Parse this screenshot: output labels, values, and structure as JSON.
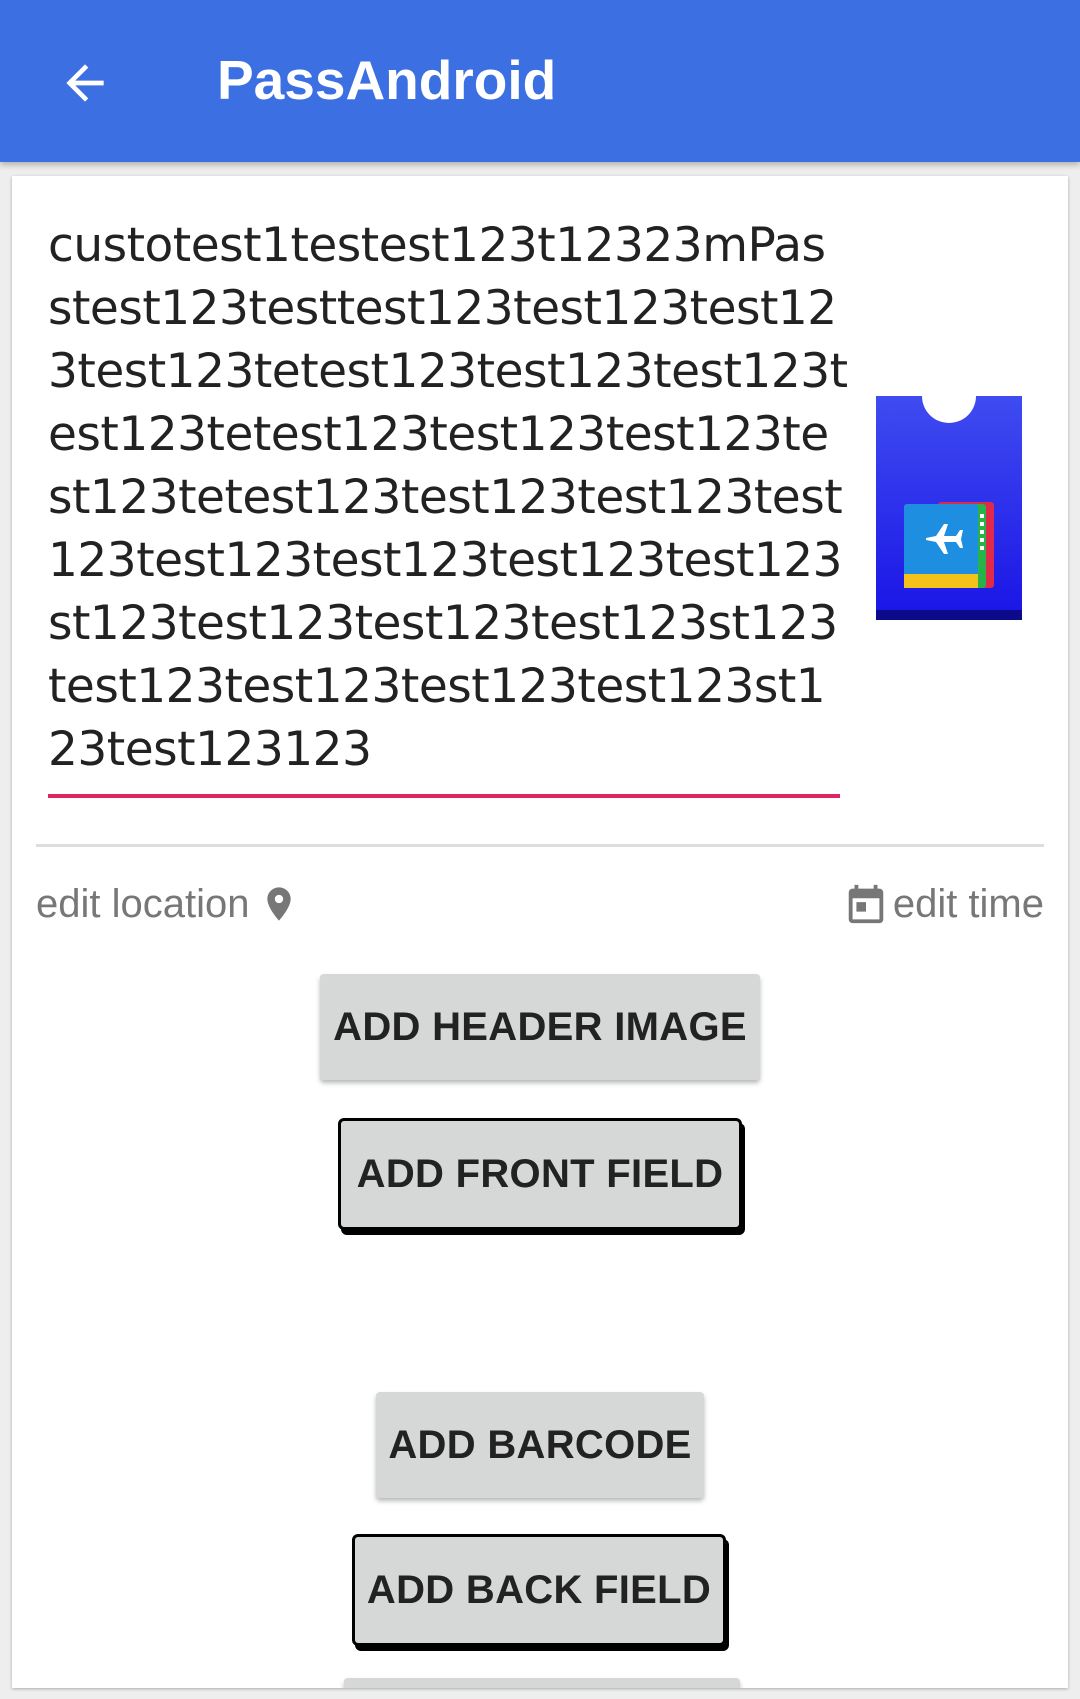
{
  "app_bar": {
    "title": "PassAndroid",
    "back_icon": "arrow-back-icon",
    "background_color": "#3b6fe2"
  },
  "pass_editor": {
    "description_value": "custotest1testest123t12323mPasstest123testtest123test123test123test123tetest123test123test123test123tetest123test123test123test123tetest123test123test123test123test123test123test123test123st123test123test123test123st123test123test123test123test123st123test123123",
    "underline_color": "#e0245e",
    "pass_icon": "boarding-pass-icon",
    "edit_location_label": "edit location",
    "location_icon": "location-pin-icon",
    "edit_time_label": "edit time",
    "calendar_icon": "calendar-icon",
    "buttons": {
      "add_header_image": "ADD HEADER IMAGE",
      "add_front_field": "ADD FRONT FIELD",
      "add_barcode": "ADD BARCODE",
      "add_back_field": "ADD BACK FIELD"
    }
  }
}
